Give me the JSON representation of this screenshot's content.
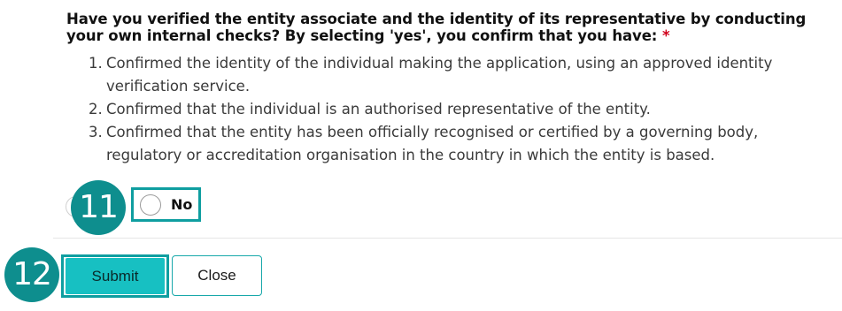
{
  "question": {
    "text": "Have you verified the entity associate and the identity of its representative by conducting your own internal checks? By selecting 'yes', you confirm that you have:",
    "required_marker": "*"
  },
  "checklist": [
    {
      "number": "1.",
      "text": "Confirmed the identity of the individual making the application, using an approved identity verification service."
    },
    {
      "number": "2.",
      "text": "Confirmed that the individual is an authorised representative of the entity."
    },
    {
      "number": "3.",
      "text": "Confirmed that the entity has been officially recognised or certified by a governing body, regulatory or accreditation organisation in the country in which the entity is based."
    }
  ],
  "options": {
    "no_label": "No"
  },
  "badges": {
    "radio_no": "11",
    "submit": "12"
  },
  "buttons": {
    "submit_label": "Submit",
    "close_label": "Close"
  },
  "colors": {
    "accent_teal": "#17c0c2",
    "badge_teal": "#0e8e8e",
    "highlight_outline": "#0f9ea0",
    "required": "#d0021b"
  }
}
